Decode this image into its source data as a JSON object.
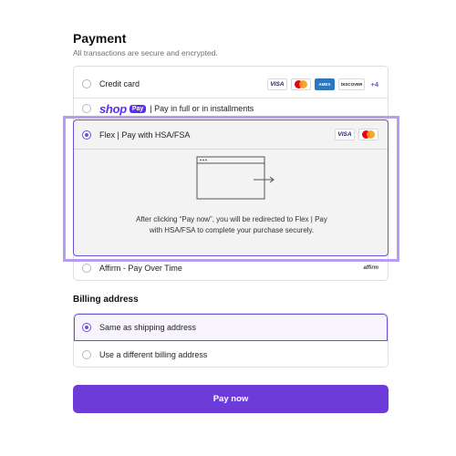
{
  "payment": {
    "title": "Payment",
    "subtitle": "All transactions are secure and encrypted.",
    "options": {
      "credit_card": {
        "label": "Credit card",
        "badges": [
          "VISA",
          "AMEX",
          "DISCOVER"
        ],
        "more_count": "+4"
      },
      "shop_pay": {
        "logo": "shop",
        "chip": "Pay",
        "label": "| Pay in full or in installments"
      },
      "flex": {
        "label": "Flex | Pay with HSA/FSA",
        "badge": "VISA",
        "redirect_text": "After clicking “Pay now”, you will be redirected to Flex | Pay with HSA/FSA to complete your purchase securely."
      },
      "affirm": {
        "label": "Affirm - Pay Over Time",
        "logo": "affirm"
      }
    },
    "selected": "flex"
  },
  "billing": {
    "title": "Billing address",
    "options": [
      "Same as shipping address",
      "Use a different billing address"
    ],
    "selected_index": 0
  },
  "pay_button": {
    "label": "Pay now",
    "color": "#6c3bd8"
  },
  "colors": {
    "accent": "#6b4fd8",
    "highlight": "#b79cf2"
  }
}
